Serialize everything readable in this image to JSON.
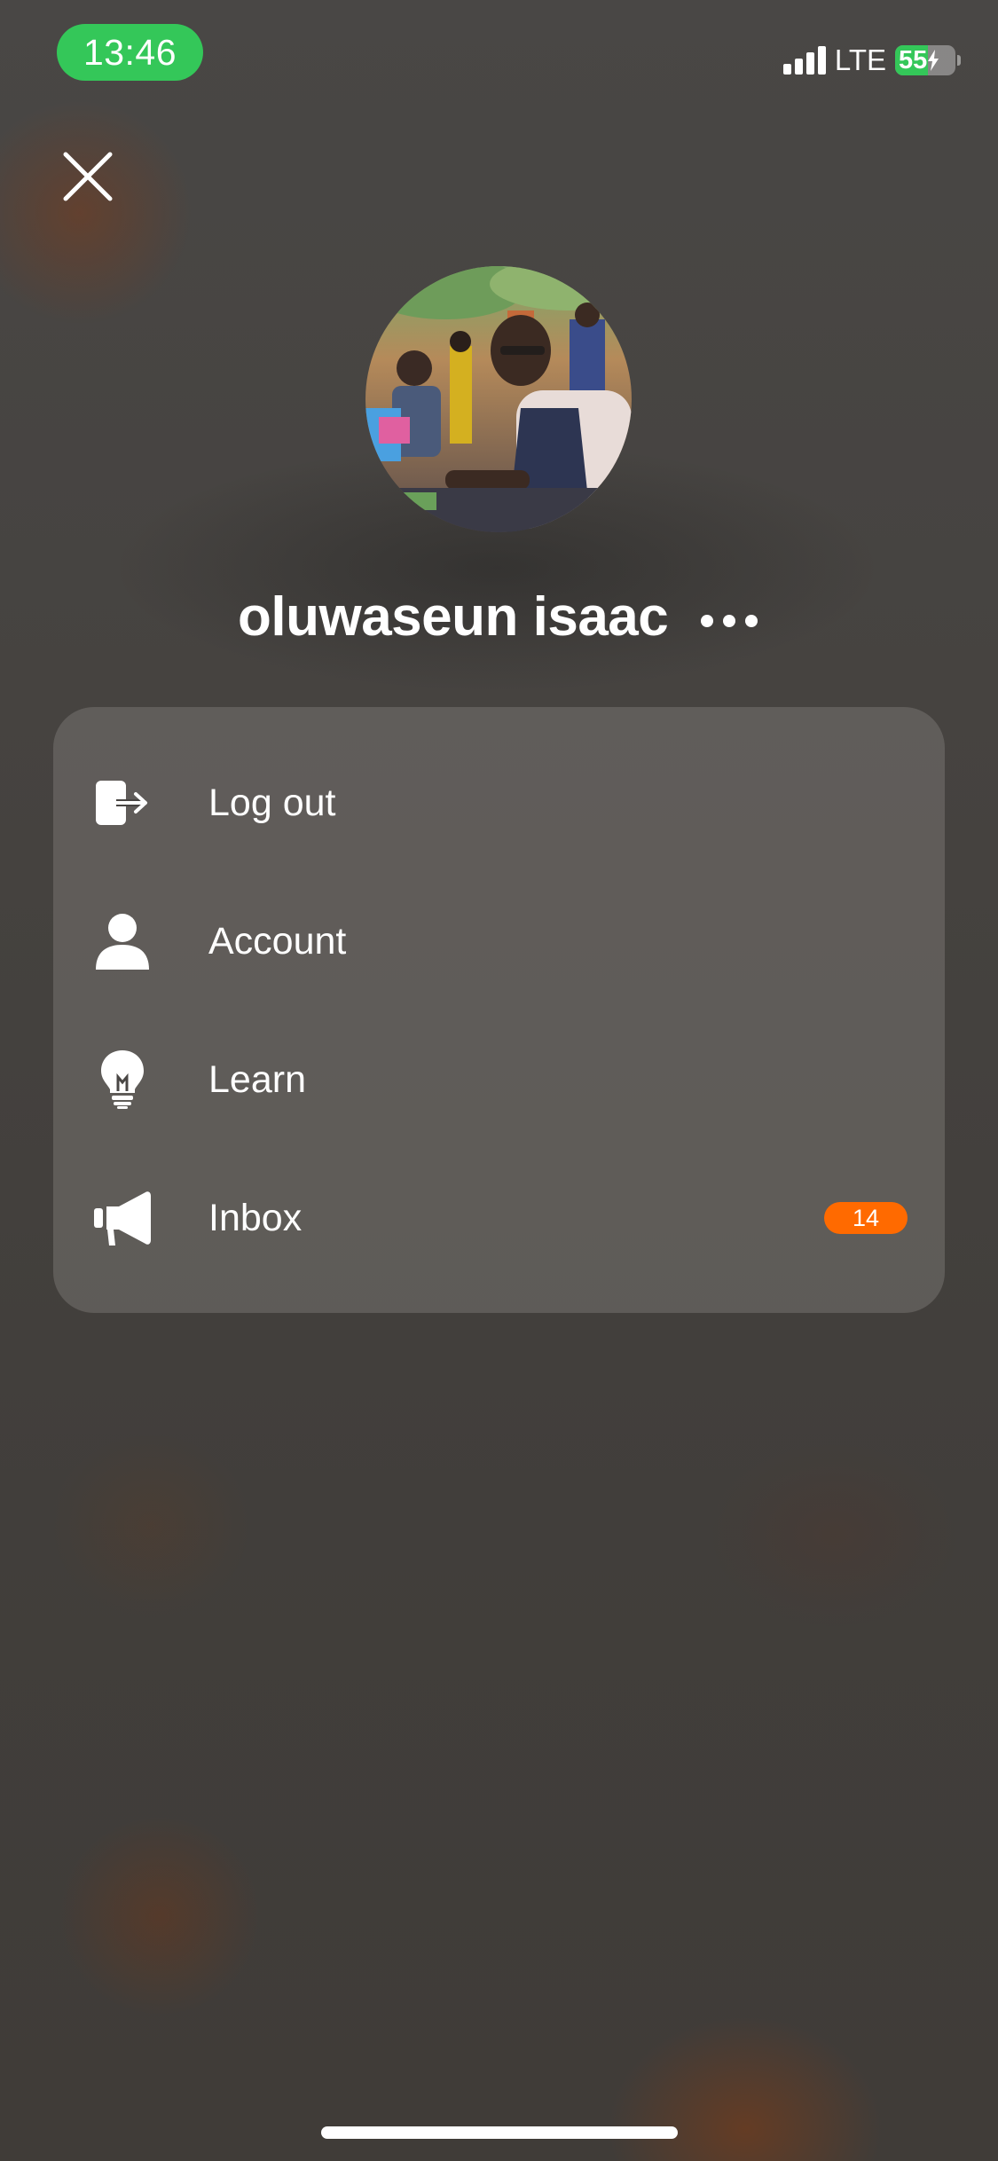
{
  "status_bar": {
    "time": "13:46",
    "network": "LTE",
    "battery_level": "55",
    "battery_percent": 55,
    "accent_color": "#34c759"
  },
  "header": {
    "close_icon": "close-icon"
  },
  "profile": {
    "name": "oluwaseun isaac",
    "more_icon": "more-horizontal-icon"
  },
  "menu": {
    "items": [
      {
        "label": "Log out",
        "icon": "logout-icon"
      },
      {
        "label": "Account",
        "icon": "user-icon"
      },
      {
        "label": "Learn",
        "icon": "lightbulb-icon"
      },
      {
        "label": "Inbox",
        "icon": "megaphone-icon",
        "badge": "14"
      }
    ]
  },
  "colors": {
    "badge": "#ff6a00"
  }
}
